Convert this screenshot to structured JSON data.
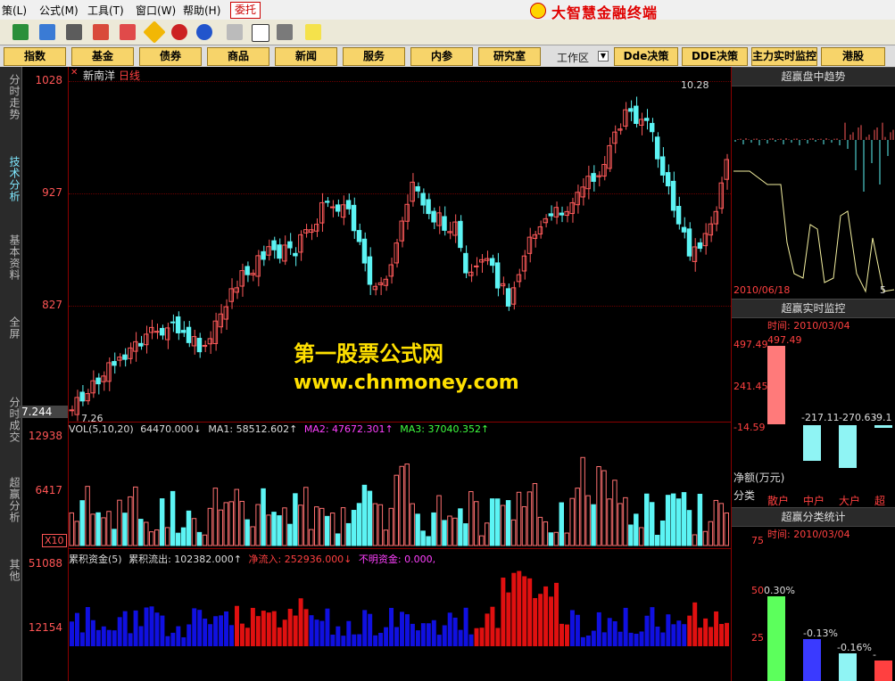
{
  "menu": [
    "策(L)",
    "公式(M)",
    "工具(T)",
    "窗口(W)",
    "帮助(H)"
  ],
  "weituo": "委托",
  "app_title": "大智慧金融终端",
  "nav": [
    "指数",
    "基金",
    "债券",
    "商品",
    "新闻",
    "服务",
    "内参",
    "研究室",
    "Dde决策",
    "DDE决策",
    "主力实时监控",
    "港股"
  ],
  "workarea_label": "工作区",
  "left_tabs": [
    "分时走势",
    "技术分析",
    "基本资料",
    "全屏",
    "分时成交",
    "超赢分析",
    "其他"
  ],
  "stock": {
    "name": "新南洋",
    "period": "日线"
  },
  "price_axis": {
    "top": "1028",
    "mid1": "927",
    "mid2": "827",
    "current": "7.244"
  },
  "annotations": {
    "high": "10.28",
    "low": "7.26"
  },
  "vol": {
    "label": "VOL(5,10,20)",
    "value": "64470.000↓",
    "ma1": "MA1: 58512.602↑",
    "ma2": "MA2: 47672.301↑",
    "ma3": "MA3: 37040.352↑",
    "axis_top": "12938",
    "axis_mid": "6417",
    "unit": "X10"
  },
  "fund": {
    "label": "累积资金(5)",
    "outflow": "累积流出: 102382.000↑",
    "netflow": "净流入: 252936.000↓",
    "unknown": "不明资金: 0.000,",
    "axis_top": "51088",
    "axis_mid": "12154"
  },
  "watermark": {
    "line1": "第一股票公式网",
    "line2": "www.chnmoney.com"
  },
  "right": {
    "trend_title": "超赢盘中趋势",
    "trend_date": "2010/06/18",
    "trend_right": "5",
    "monitor_title": "超赢实时监控",
    "monitor_time": "时间: 2010/03/04",
    "monitor_axis": [
      "497.49",
      "241.45",
      "-14.59"
    ],
    "monitor_top": "497.49",
    "monitor_values": [
      "-217.11",
      "-270.63",
      "-9.1"
    ],
    "net_label": "净额(万元)",
    "class_label": "分类",
    "classes": [
      "散户",
      "中户",
      "大户",
      "超大"
    ],
    "stats_title": "超赢分类统计",
    "stats_time": "时间: 2010/03/04",
    "stats_axis": [
      "75",
      "50",
      "25"
    ],
    "stats_values": [
      "0.30%",
      "-0.13%",
      "-0.16%",
      "-"
    ]
  }
}
